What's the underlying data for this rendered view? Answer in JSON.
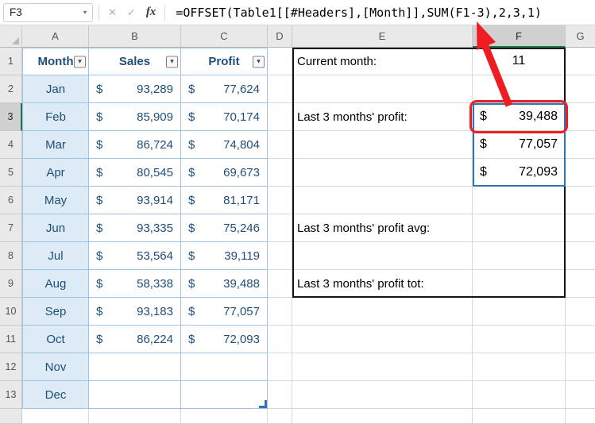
{
  "formula_bar": {
    "name_box": "F3",
    "formula": "=OFFSET(Table1[[#Headers],[Month]],SUM(F1-3),2,3,1)"
  },
  "icons": {
    "name_box_chevron": "▾",
    "cancel": "✕",
    "enter": "✓",
    "fx": "fx",
    "filter": "▾"
  },
  "grid": {
    "columns": [
      "A",
      "B",
      "C",
      "D",
      "E",
      "F",
      "G"
    ],
    "rows": [
      "1",
      "2",
      "3",
      "4",
      "5",
      "6",
      "7",
      "8",
      "9",
      "10",
      "11",
      "12",
      "13"
    ]
  },
  "currency": "$",
  "table": {
    "headers": [
      "Month",
      "Sales",
      "Profit"
    ],
    "rows": [
      {
        "month": "Jan",
        "sales": "93,289",
        "profit": "77,624"
      },
      {
        "month": "Feb",
        "sales": "85,909",
        "profit": "70,174"
      },
      {
        "month": "Mar",
        "sales": "86,724",
        "profit": "74,804"
      },
      {
        "month": "Apr",
        "sales": "80,545",
        "profit": "69,673"
      },
      {
        "month": "May",
        "sales": "93,914",
        "profit": "81,171"
      },
      {
        "month": "Jun",
        "sales": "93,335",
        "profit": "75,246"
      },
      {
        "month": "Jul",
        "sales": "53,564",
        "profit": "39,119"
      },
      {
        "month": "Aug",
        "sales": "58,338",
        "profit": "39,488"
      },
      {
        "month": "Sep",
        "sales": "93,183",
        "profit": "77,057"
      },
      {
        "month": "Oct",
        "sales": "86,224",
        "profit": "72,093"
      },
      {
        "month": "Nov",
        "sales": "",
        "profit": ""
      },
      {
        "month": "Dec",
        "sales": "",
        "profit": ""
      }
    ]
  },
  "panel": {
    "current_month": {
      "label": "Current month:",
      "value": "11"
    },
    "last3_profit": {
      "label": "Last 3 months' profit:",
      "values": [
        "39,488",
        "77,057",
        "72,093"
      ]
    },
    "avg_label": "Last 3 months' profit avg:",
    "tot_label": "Last 3 months' profit tot:"
  },
  "colors": {
    "table_text": "#1f4e79",
    "table_border": "#9dc3e6",
    "month_fill": "#ddebf7",
    "grid_line": "#d9d9d9",
    "header_bg": "#e9e9e9",
    "selected_header_bg": "#d0d0d0",
    "selection_accent": "#217346",
    "spill_border": "#2e75b6",
    "annotation_red": "#ee1c23",
    "panel_box_border": "#151515"
  }
}
